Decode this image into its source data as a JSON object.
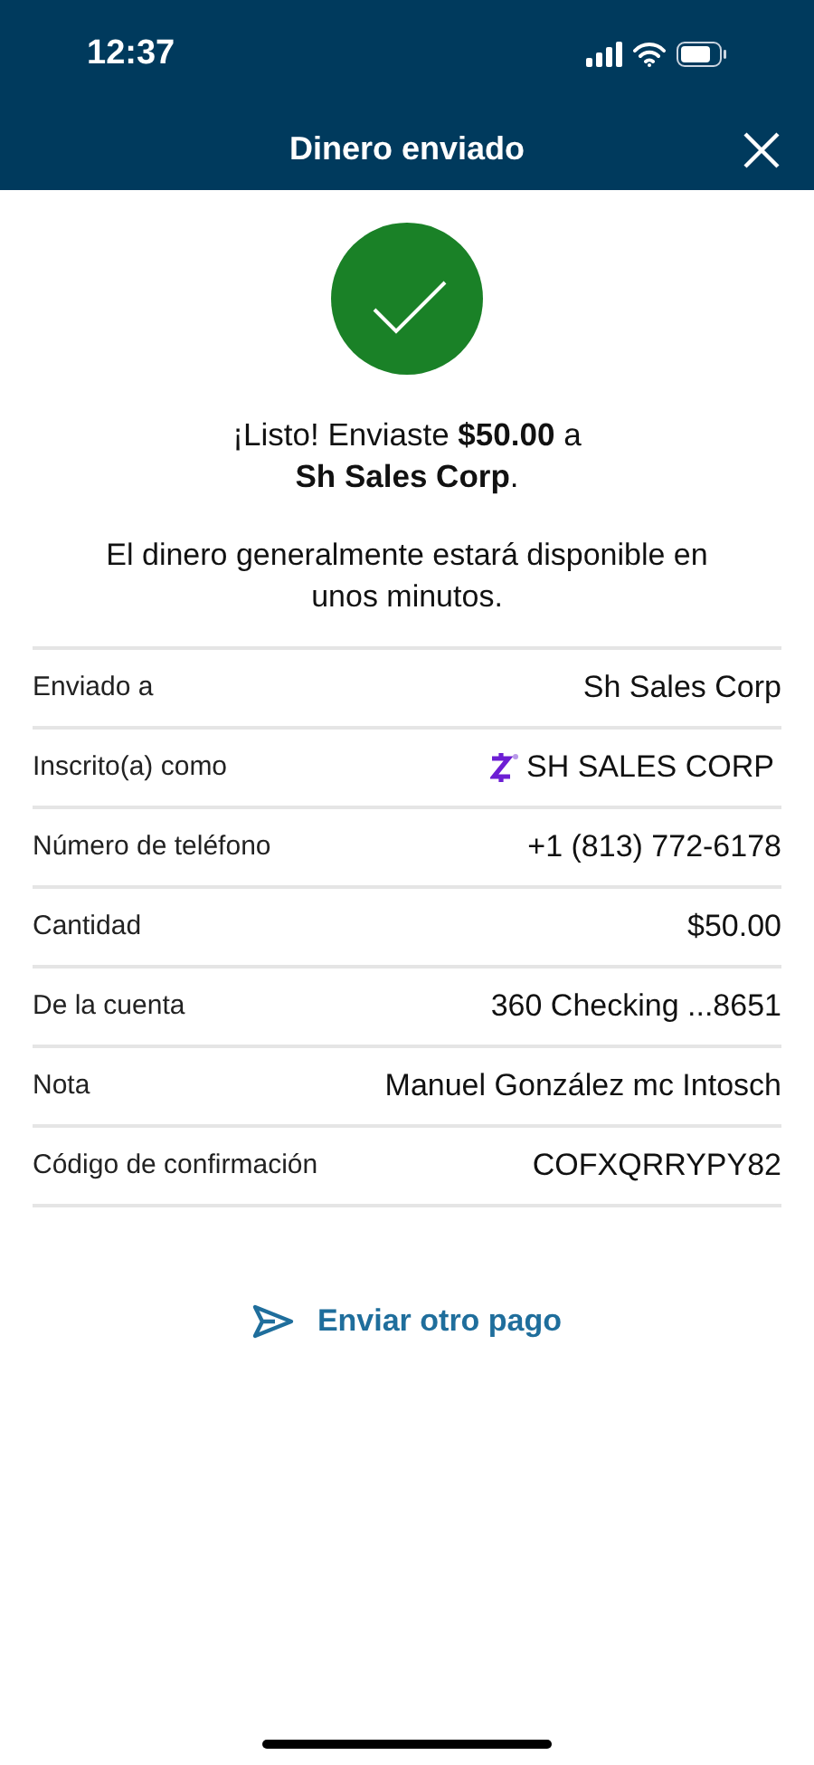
{
  "status_bar": {
    "time": "12:37"
  },
  "header": {
    "title": "Dinero enviado"
  },
  "confirmation": {
    "message": "¡Listo! Enviaste **$50.00** a",
    "recipient": "Sh Sales Corp",
    "recipient_end": ".",
    "note": "El dinero generalmente estará disponible en unos minutos."
  },
  "details": [
    {
      "kind": "plain",
      "label": "Enviado a",
      "value": "Sh Sales Corp"
    },
    {
      "kind": "logo",
      "label": "Inscrito(a) como",
      "value": "SH SALES CORP"
    },
    {
      "kind": "plain",
      "label": "Número de teléfono",
      "value": "+1 (813) 772-6178"
    },
    {
      "kind": "plain",
      "label": "Cantidad",
      "value": "$50.00"
    },
    {
      "kind": "plain",
      "label": "De la cuenta",
      "value": "360 Checking ...8651"
    },
    {
      "kind": "plain",
      "label": "Nota",
      "value": "Manuel González mc Intosch"
    },
    {
      "kind": "plain",
      "label": "Código de confirmación",
      "value": "COFXQRRYPY82"
    }
  ],
  "action": {
    "label": "Enviar otro pago"
  }
}
